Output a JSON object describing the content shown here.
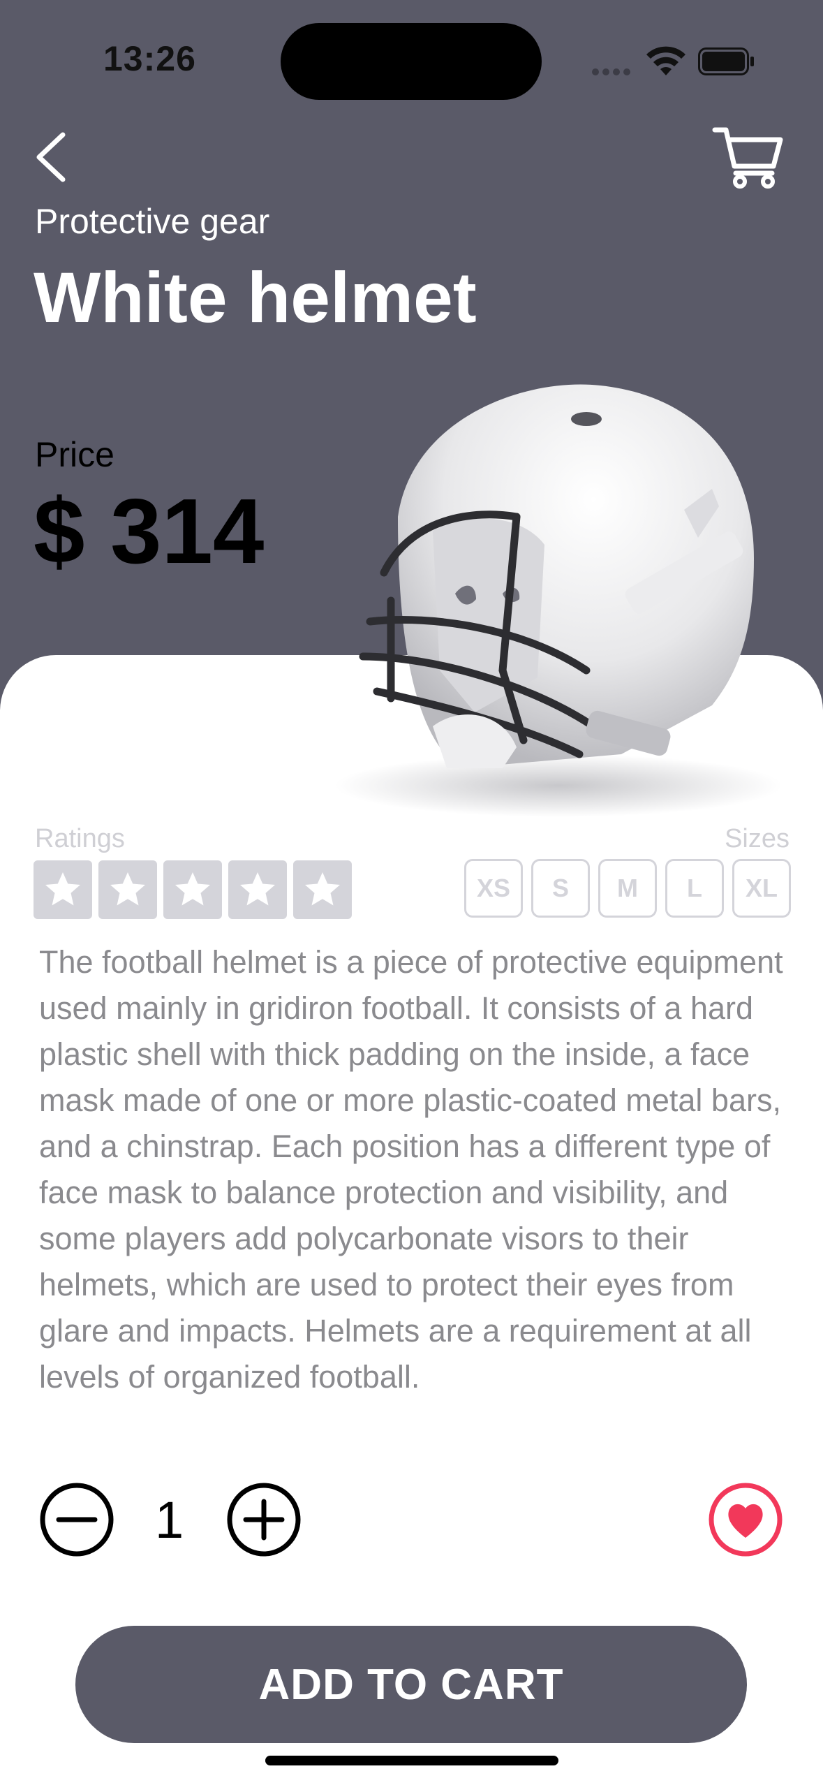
{
  "status_bar": {
    "time": "13:26"
  },
  "header": {
    "back_icon": "chevron-left-icon",
    "cart_icon": "cart-icon",
    "category": "Protective gear",
    "title": "White helmet",
    "price_label": "Price",
    "price": "$ 314"
  },
  "product_image": "football-helmet-image",
  "ratings": {
    "label": "Ratings",
    "stars_filled": 0,
    "stars_total": 5
  },
  "sizes": {
    "label": "Sizes",
    "options": [
      "XS",
      "S",
      "M",
      "L",
      "XL"
    ]
  },
  "description": "The football helmet is a piece of protective equipment used mainly in gridiron football. It consists of a hard plastic shell with thick padding on the inside, a face mask made of one or more plastic-coated metal bars, and a chinstrap. Each position has a different type of face mask to balance protection and visibility, and some players add polycarbonate visors to their helmets, which are used to protect their eyes from glare and impacts. Helmets are a requirement at all levels of organized football.",
  "quantity": {
    "value": "1"
  },
  "favorite": {
    "active": true
  },
  "add_to_cart": {
    "label": "ADD TO CART"
  },
  "colors": {
    "header_bg": "#5a5a68",
    "accent_red": "#f2385a",
    "muted": "#d4d4da",
    "text_muted": "#8a8a8e"
  }
}
